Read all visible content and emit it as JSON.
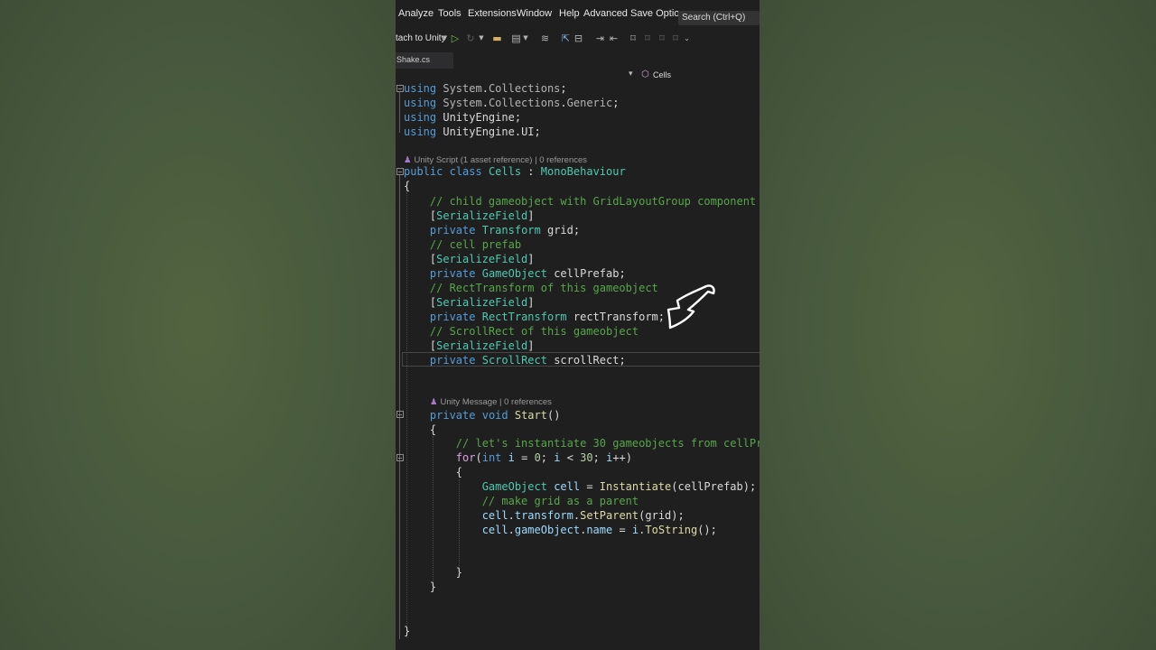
{
  "menu": {
    "items": [
      "Analyze",
      "Tools",
      "Extensions",
      "Window",
      "Help",
      "Advanced Save Options..."
    ],
    "search_placeholder": "Search (Ctrl+Q)"
  },
  "toolbar": {
    "attach_label": "tach to Unity",
    "icons": [
      "dropdown-caret-icon",
      "play-icon",
      "refresh-icon",
      "open-folder-icon",
      "save-all-icon",
      "format-icon",
      "step-icon",
      "breakpoint-icon",
      "indent-icon",
      "outdent-icon",
      "bookmark-icon",
      "prev-bookmark-icon",
      "next-bookmark-icon",
      "clear-bookmark-icon",
      "overflow-icon"
    ]
  },
  "tab": {
    "filename": "Shake.cs"
  },
  "navbar": {
    "class_name": "Cells"
  },
  "codelens": {
    "class_lens": "Unity Script (1 asset reference) | 0 references",
    "method_lens": "Unity Message | 0 references"
  },
  "code": [
    [
      [
        "k",
        "using"
      ],
      [
        "g",
        " System"
      ],
      [
        "p",
        "."
      ],
      [
        "g",
        "Collections"
      ],
      [
        "p",
        ";"
      ]
    ],
    [
      [
        "k",
        "using"
      ],
      [
        "g",
        " System"
      ],
      [
        "p",
        "."
      ],
      [
        "g",
        "Collections"
      ],
      [
        "p",
        "."
      ],
      [
        "g",
        "Generic"
      ],
      [
        "p",
        ";"
      ]
    ],
    [
      [
        "k",
        "using"
      ],
      [
        "p",
        " UnityEngine;"
      ]
    ],
    [
      [
        "k",
        "using"
      ],
      [
        "p",
        " UnityEngine"
      ],
      [
        "p",
        "."
      ],
      [
        "p",
        "UI;"
      ]
    ],
    [
      [
        "k",
        "public"
      ],
      [
        "p",
        " "
      ],
      [
        "k",
        "class"
      ],
      [
        "p",
        " "
      ],
      [
        "t",
        "Cells"
      ],
      [
        "p",
        " : "
      ],
      [
        "t",
        "MonoBehaviour"
      ]
    ],
    [
      [
        "p",
        "{"
      ]
    ],
    [
      [
        "p",
        "    "
      ],
      [
        "c",
        "// child gameobject with GridLayoutGroup component"
      ]
    ],
    [
      [
        "p",
        "    ["
      ],
      [
        "t",
        "SerializeField"
      ],
      [
        "p",
        "]"
      ]
    ],
    [
      [
        "p",
        "    "
      ],
      [
        "k",
        "private"
      ],
      [
        "p",
        " "
      ],
      [
        "t",
        "Transform"
      ],
      [
        "p",
        " grid;"
      ]
    ],
    [
      [
        "p",
        "    "
      ],
      [
        "c",
        "// cell prefab"
      ]
    ],
    [
      [
        "p",
        "    ["
      ],
      [
        "t",
        "SerializeField"
      ],
      [
        "p",
        "]"
      ]
    ],
    [
      [
        "p",
        "    "
      ],
      [
        "k",
        "private"
      ],
      [
        "p",
        " "
      ],
      [
        "t",
        "GameObject"
      ],
      [
        "p",
        " cellPrefab;"
      ]
    ],
    [
      [
        "p",
        "    "
      ],
      [
        "c",
        "// RectTransform of this gameobject"
      ]
    ],
    [
      [
        "p",
        "    ["
      ],
      [
        "t",
        "SerializeField"
      ],
      [
        "p",
        "]"
      ]
    ],
    [
      [
        "p",
        "    "
      ],
      [
        "k",
        "private"
      ],
      [
        "p",
        " "
      ],
      [
        "t",
        "RectTransform"
      ],
      [
        "p",
        " rectTransform;"
      ]
    ],
    [
      [
        "p",
        "    "
      ],
      [
        "c",
        "// ScrollRect of this gameobject"
      ]
    ],
    [
      [
        "p",
        "    ["
      ],
      [
        "t",
        "SerializeField"
      ],
      [
        "p",
        "]"
      ]
    ],
    [
      [
        "p",
        "    "
      ],
      [
        "k",
        "private"
      ],
      [
        "p",
        " "
      ],
      [
        "t",
        "ScrollRect"
      ],
      [
        "p",
        " scrollRect;"
      ]
    ],
    [
      [
        "p",
        "    "
      ],
      [
        "k",
        "private"
      ],
      [
        "p",
        " "
      ],
      [
        "k",
        "void"
      ],
      [
        "p",
        " "
      ],
      [
        "m",
        "Start"
      ],
      [
        "p",
        "()"
      ]
    ],
    [
      [
        "p",
        "    {"
      ]
    ],
    [
      [
        "p",
        "        "
      ],
      [
        "c",
        "// let's instantiate 30 gameobjects from cellPr"
      ]
    ],
    [
      [
        "p",
        "        "
      ],
      [
        "f",
        "for"
      ],
      [
        "p",
        "("
      ],
      [
        "k",
        "int"
      ],
      [
        "p",
        " "
      ],
      [
        "v",
        "i"
      ],
      [
        "p",
        " = "
      ],
      [
        "n",
        "0"
      ],
      [
        "p",
        "; "
      ],
      [
        "v",
        "i"
      ],
      [
        "p",
        " < "
      ],
      [
        "n",
        "30"
      ],
      [
        "p",
        "; "
      ],
      [
        "v",
        "i"
      ],
      [
        "p",
        "++)"
      ]
    ],
    [
      [
        "p",
        "        {"
      ]
    ],
    [
      [
        "p",
        "            "
      ],
      [
        "t",
        "GameObject"
      ],
      [
        "p",
        " "
      ],
      [
        "v",
        "cell"
      ],
      [
        "p",
        " = "
      ],
      [
        "m",
        "Instantiate"
      ],
      [
        "p",
        "(cellPrefab);"
      ]
    ],
    [
      [
        "p",
        "            "
      ],
      [
        "c",
        "// make grid as a parent"
      ]
    ],
    [
      [
        "p",
        "            "
      ],
      [
        "v",
        "cell"
      ],
      [
        "p",
        "."
      ],
      [
        "v",
        "transform"
      ],
      [
        "p",
        "."
      ],
      [
        "m",
        "SetParent"
      ],
      [
        "p",
        "(grid);"
      ]
    ],
    [
      [
        "p",
        "            "
      ],
      [
        "v",
        "cell"
      ],
      [
        "p",
        "."
      ],
      [
        "v",
        "gameObject"
      ],
      [
        "p",
        "."
      ],
      [
        "v",
        "name"
      ],
      [
        "p",
        " = "
      ],
      [
        "v",
        "i"
      ],
      [
        "p",
        "."
      ],
      [
        "m",
        "ToString"
      ],
      [
        "p",
        "();"
      ]
    ],
    [
      [
        "p",
        "        }"
      ]
    ],
    [
      [
        "p",
        "    }"
      ]
    ],
    [
      [
        "p",
        "}"
      ]
    ]
  ],
  "colors": {
    "keyword": "#569cd6",
    "comment": "#57a64a",
    "type": "#4ec9b0",
    "method": "#dcdcaa",
    "variable": "#9cdcfe",
    "number": "#b5cea8",
    "control": "#d8a0df",
    "editor_bg": "#1f1f1f",
    "side_bg": "#4a5a40"
  }
}
